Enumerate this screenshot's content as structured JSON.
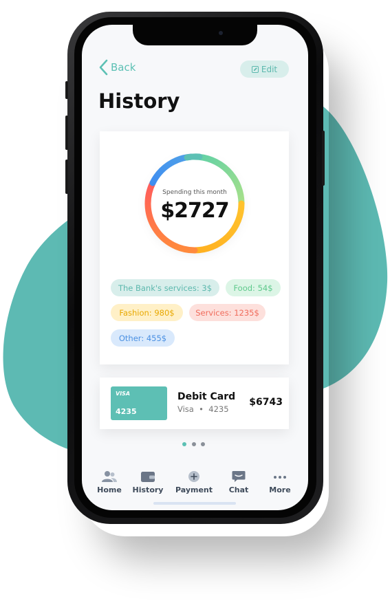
{
  "header": {
    "back_label": "Back",
    "edit_label": "Edit",
    "title": "History"
  },
  "spending": {
    "label": "Spending this month",
    "total": "$2727",
    "tags": [
      {
        "label": "The Bank's services: 3$",
        "color": "#5cb8ad",
        "bg": "#d8eeeb"
      },
      {
        "label": "Food: 54$",
        "color": "#5fc98c",
        "bg": "#dcf5e6"
      },
      {
        "label": "Fashion: 980$",
        "color": "#e8a800",
        "bg": "#fff0c7"
      },
      {
        "label": "Services: 1235$",
        "color": "#f06c5c",
        "bg": "#fde0dc"
      },
      {
        "label": "Other: 455$",
        "color": "#4a90e2",
        "bg": "#d9e9fc"
      }
    ]
  },
  "debit_card": {
    "card_brand": "VISA",
    "card_number": "4235",
    "title": "Debit Card",
    "network": "Visa",
    "last_digits": "4235",
    "amount": "$6743"
  },
  "pagination": {
    "pages": 3,
    "active_index": 0
  },
  "bottom_nav": [
    {
      "label": "Home",
      "icon": "users-icon"
    },
    {
      "label": "History",
      "icon": "wallet-icon"
    },
    {
      "label": "Payment",
      "icon": "plus-circle-icon"
    },
    {
      "label": "Chat",
      "icon": "chat-icon"
    },
    {
      "label": "More",
      "icon": "more-dots-icon"
    }
  ],
  "colors": {
    "accent": "#5cc0b4",
    "blob": "#5dbab3"
  }
}
